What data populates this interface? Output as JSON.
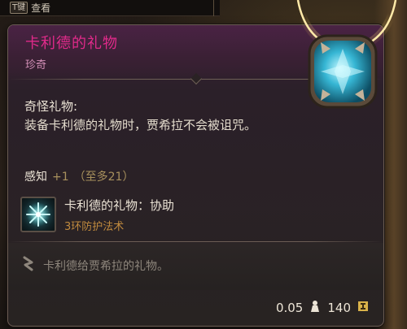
{
  "hotkey": {
    "key": "T键",
    "label": "查看"
  },
  "item": {
    "name": "卡利德的礼物",
    "rarity": "珍奇",
    "passive_title": "奇怪礼物:",
    "passive_desc": "装备卡利德的礼物时，贾希拉不会被诅咒。",
    "stat_name": "感知",
    "stat_value": "+1",
    "stat_cap": "（至多21）",
    "spell_name": "卡利德的礼物：协助",
    "spell_level": "3环防护法术",
    "flavor": "卡利德给贾希拉的礼物。"
  },
  "footer": {
    "weight": "0.05",
    "value": "140"
  },
  "colors": {
    "name": "#e02a8a",
    "rarity": "#d28fb6",
    "stat": "#a8915d",
    "spell_level": "#c08a3e",
    "flavor": "#8e867c"
  },
  "icons": {
    "pendant": "turquoise-pendant-icon",
    "spell": "aid-spell-icon",
    "flavor": "quill-icon",
    "weight": "weight-icon",
    "value": "gold-coin-icon"
  }
}
